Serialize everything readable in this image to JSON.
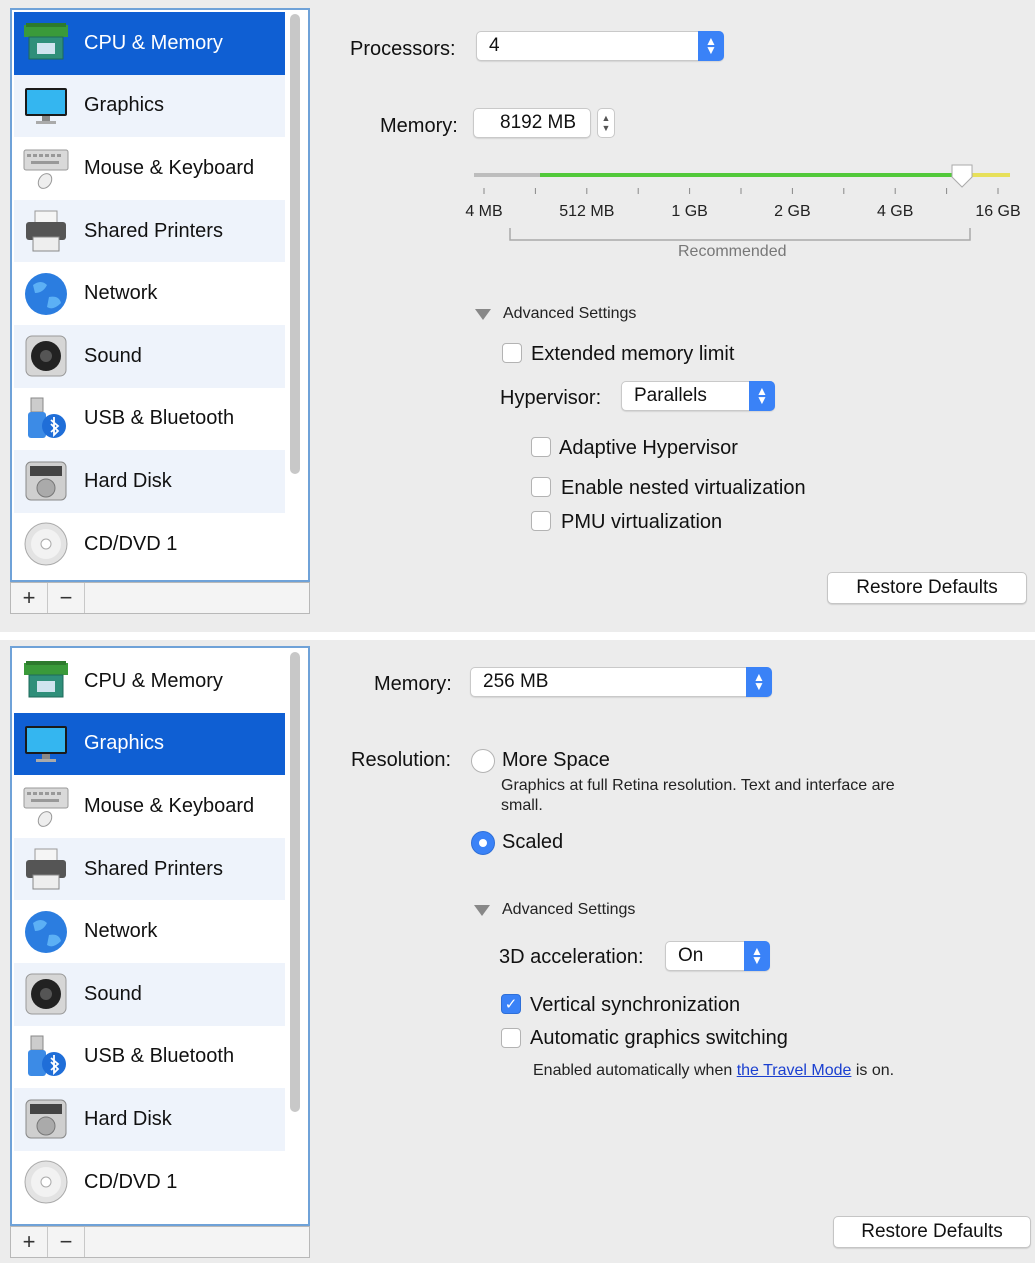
{
  "sidebar_items": [
    {
      "label": "CPU & Memory",
      "icon": "memory-chip-icon"
    },
    {
      "label": "Graphics",
      "icon": "monitor-icon"
    },
    {
      "label": "Mouse & Keyboard",
      "icon": "keyboard-mouse-icon"
    },
    {
      "label": "Shared Printers",
      "icon": "printer-icon"
    },
    {
      "label": "Network",
      "icon": "globe-icon"
    },
    {
      "label": "Sound",
      "icon": "speaker-icon"
    },
    {
      "label": "USB & Bluetooth",
      "icon": "usb-bluetooth-icon"
    },
    {
      "label": "Hard Disk",
      "icon": "hard-disk-icon"
    },
    {
      "label": "CD/DVD 1",
      "icon": "cd-dvd-icon"
    }
  ],
  "footer": {
    "add": "+",
    "remove": "−"
  },
  "cpu_panel": {
    "selected_item": "CPU & Memory",
    "processors_label": "Processors:",
    "processors_value": "4",
    "memory_label": "Memory:",
    "memory_value": "8192 MB",
    "memory_slider": {
      "ticks": [
        "4 MB",
        "512 MB",
        "1 GB",
        "2 GB",
        "4 GB",
        "16 GB"
      ],
      "position_fraction": 0.93,
      "recommended_label": "Recommended"
    },
    "advanced_label": "Advanced Settings",
    "extended_memory_label": "Extended memory limit",
    "extended_memory_checked": false,
    "hypervisor_label": "Hypervisor:",
    "hypervisor_value": "Parallels",
    "adaptive_label": "Adaptive Hypervisor",
    "adaptive_checked": false,
    "nested_label": "Enable nested virtualization",
    "nested_checked": false,
    "pmu_label": "PMU virtualization",
    "pmu_checked": false,
    "restore_label": "Restore Defaults"
  },
  "graphics_panel": {
    "selected_item": "Graphics",
    "memory_label": "Memory:",
    "memory_value": "256 MB",
    "resolution_label": "Resolution:",
    "more_space_label": "More Space",
    "more_space_desc_1": "Graphics at full Retina resolution. Text and interface are",
    "more_space_desc_2": "small.",
    "scaled_label": "Scaled",
    "selected_resolution": "Scaled",
    "advanced_label": "Advanced Settings",
    "accel_label": "3D acceleration:",
    "accel_value": "On",
    "vsync_label": "Vertical synchronization",
    "vsync_checked": true,
    "auto_switch_label": "Automatic graphics switching",
    "auto_switch_checked": false,
    "note_prefix": "Enabled automatically when ",
    "note_link": "the Travel Mode",
    "note_suffix": " is on.",
    "restore_label": "Restore Defaults"
  },
  "colors": {
    "selection": "#0f5fd3",
    "accent": "#3a82f7",
    "slider_green": "#52c93a",
    "slider_yellow": "#e7e05a"
  }
}
